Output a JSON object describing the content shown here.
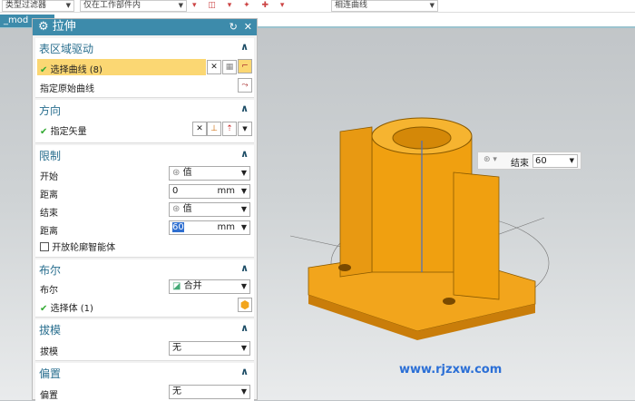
{
  "toolbar": {
    "filter": "类型过滤器",
    "scope": "仅在工作部件内",
    "curve_rule": "相连曲线",
    "icons": "▾ ◫ ▾ ✦ ✚ ▾"
  },
  "model_tab": "_mod",
  "dialog": {
    "title": "拉伸",
    "reset_icon": "↻",
    "close_icon": "✕",
    "sections": {
      "section_area": {
        "title": "表区域驱动",
        "select_curve": "选择曲线 (8)",
        "origin_curve": "指定原始曲线"
      },
      "direction": {
        "title": "方向",
        "vector": "指定矢量"
      },
      "limits": {
        "title": "限制",
        "start_label": "开始",
        "start_value": "值",
        "start_dist_label": "距离",
        "start_dist": "0",
        "end_label": "结束",
        "end_value": "值",
        "end_dist_label": "距离",
        "end_dist": "60",
        "unit": "mm",
        "open_profile": "开放轮廓智能体"
      },
      "boolean": {
        "title": "布尔",
        "label": "布尔",
        "value": "合并",
        "select_body": "选择体 (1)"
      },
      "draft": {
        "title": "拔模",
        "label": "拔模",
        "value": "无"
      },
      "offset": {
        "title": "偏置",
        "label": "偏置",
        "value": "无"
      }
    }
  },
  "float_input": {
    "label": "结束",
    "value": "60"
  },
  "watermark": "www.rjzxw.com",
  "colors": {
    "accent": "#3d8bab",
    "model": "#f2a51c",
    "selected_row": "#fbd773"
  }
}
